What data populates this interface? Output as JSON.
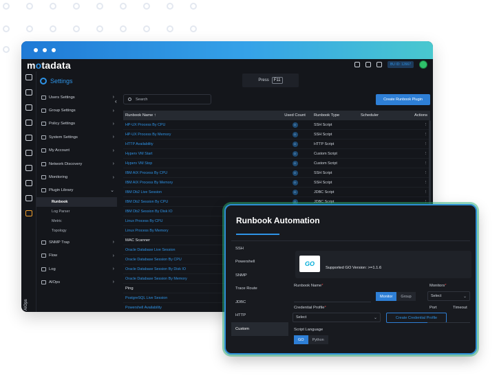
{
  "app": {
    "logo": "motadata",
    "settings_title": "Settings",
    "bu_id": "BU ID: 12667",
    "press_label": "Press",
    "press_key": "F11",
    "rail_label": "AIOps"
  },
  "sidebar": {
    "items": [
      {
        "label": "Users Settings",
        "icon": "users-icon"
      },
      {
        "label": "Group Settings",
        "icon": "group-icon"
      },
      {
        "label": "Policy Settings",
        "icon": "policy-icon"
      },
      {
        "label": "System Settings",
        "icon": "system-icon"
      },
      {
        "label": "My Account",
        "icon": "account-icon"
      },
      {
        "label": "Network Discovery",
        "icon": "discovery-icon"
      },
      {
        "label": "Monitoring",
        "icon": "monitor-icon"
      },
      {
        "label": "Plugin Library",
        "icon": "plugin-icon"
      }
    ],
    "subitems": [
      "Runbook",
      "Log Parser",
      "Metric",
      "Topology"
    ],
    "items_after": [
      {
        "label": "SNMP Trap",
        "icon": "snmp-icon"
      },
      {
        "label": "Flow",
        "icon": "flow-icon"
      },
      {
        "label": "Log",
        "icon": "log-icon"
      },
      {
        "label": "AIOps",
        "icon": "aiops-icon"
      }
    ]
  },
  "toolbar": {
    "search_placeholder": "Search",
    "create_button": "Create Runbook Plugin"
  },
  "table": {
    "headers": [
      "Runbook Name",
      "Used Count",
      "Runbook Type",
      "Scheduler",
      "Actions"
    ],
    "sort_indicator": "↑",
    "rows": [
      {
        "name": "HP-UX Process By CPU",
        "count": "0",
        "type": "SSH Script"
      },
      {
        "name": "HP-UX Process By Memory",
        "count": "0",
        "type": "SSH Script"
      },
      {
        "name": "HTTP Availability",
        "count": "0",
        "type": "HTTP Script"
      },
      {
        "name": "Hyperv VM Start",
        "count": "0",
        "type": "Custom Script"
      },
      {
        "name": "Hyperv VM Stop",
        "count": "0",
        "type": "Custom Script"
      },
      {
        "name": "IBM AIX Process By CPU",
        "count": "0",
        "type": "SSH Script"
      },
      {
        "name": "IBM AIX Process By Memory",
        "count": "0",
        "type": "SSH Script"
      },
      {
        "name": "IBM Db2 Live Session",
        "count": "0",
        "type": "JDBC Script"
      },
      {
        "name": "IBM Db2 Session By CPU",
        "count": "0",
        "type": "JDBC Script"
      },
      {
        "name": "IBM Db2 Session By Disk IO",
        "count": "",
        "type": ""
      },
      {
        "name": "Linux Process By CPU",
        "count": "",
        "type": ""
      },
      {
        "name": "Linux Process By Memory",
        "count": "",
        "type": ""
      }
    ],
    "group_mac": "MAC Scanner",
    "rows_mac": [
      "Oracle Database Live Session",
      "Oracle Database Session By CPU",
      "Oracle Database Session By Disk IO",
      "Oracle Database Session By Memory"
    ],
    "group_ping": "Ping",
    "rows_ping": [
      "PostgreSQL Live Session",
      "Powershell Availability"
    ]
  },
  "dialog": {
    "title": "Runbook Automation",
    "nav": [
      "SSH",
      "Powershell",
      "SNMP",
      "Trace Route",
      "JDBC",
      "HTTP",
      "Custom"
    ],
    "active_nav": "Custom",
    "go_logo": "GO",
    "go_version": "Supported GO Version: >=1.1.6",
    "runbook_name_label": "Runbook Name",
    "monitors_label": "Monitors",
    "monitor_option": "Monitor",
    "group_option": "Group",
    "monitors_select": "Select",
    "credential_label": "Credential Profile",
    "credential_select": "Select",
    "create_credential_btn": "Create Credential Profile",
    "port_label": "Port",
    "timeout_label": "Timeout",
    "script_lang_label": "Script Language",
    "lang_go": "GO",
    "lang_python": "Python",
    "required_mark": "*"
  },
  "colors": {
    "accent": "#2e93e6",
    "button": "#2e7fd6",
    "background": "#14161b",
    "active_rail": "#f0a030"
  }
}
